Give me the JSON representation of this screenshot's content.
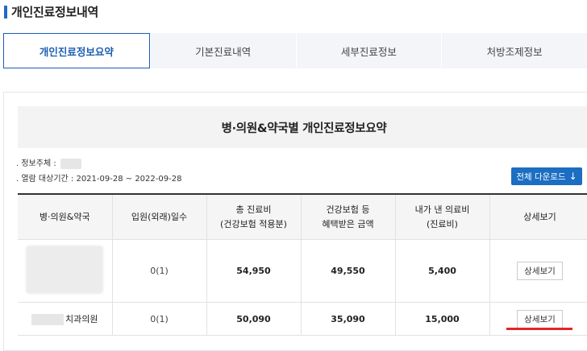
{
  "page": {
    "title": "개인진료정보내역"
  },
  "tabs": [
    {
      "label": "개인진료정보요약",
      "active": true
    },
    {
      "label": "기본진료내역",
      "active": false
    },
    {
      "label": "세부진료정보",
      "active": false
    },
    {
      "label": "처방조제정보",
      "active": false
    }
  ],
  "summary": {
    "title": "병·의원&약국별 개인진료정보요약"
  },
  "meta": {
    "subject_label": ". 정보주체 :",
    "period_label": ". 열람 대상기간 : 2021-09-28 ~ 2022-09-28"
  },
  "download": {
    "label": "전체 다운로드"
  },
  "table": {
    "headers": [
      [
        "병·의원&약국"
      ],
      [
        "입원(외래)일수"
      ],
      [
        "총 진료비",
        "(건강보험 적용분)"
      ],
      [
        "건강보험 등",
        "혜택받은 금액"
      ],
      [
        "내가 낸 의료비",
        "(진료비)"
      ],
      [
        "상세보기"
      ]
    ],
    "rows": [
      {
        "name": "",
        "days": "0(1)",
        "total": "54,950",
        "benefit": "49,550",
        "paid": "5,400",
        "detail": "상세보기"
      },
      {
        "name": "치과의원",
        "days": "0(1)",
        "total": "50,090",
        "benefit": "35,090",
        "paid": "15,000",
        "detail": "상세보기"
      }
    ]
  },
  "colors": {
    "accent": "#1b6ec2",
    "highlight": "#e0262b"
  }
}
